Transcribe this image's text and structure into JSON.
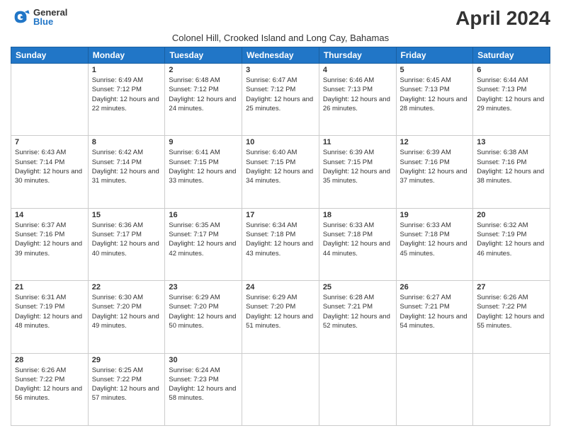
{
  "logo": {
    "general": "General",
    "blue": "Blue"
  },
  "title": "April 2024",
  "subtitle": "Colonel Hill, Crooked Island and Long Cay, Bahamas",
  "days_of_week": [
    "Sunday",
    "Monday",
    "Tuesday",
    "Wednesday",
    "Thursday",
    "Friday",
    "Saturday"
  ],
  "weeks": [
    [
      {
        "day": "",
        "info": ""
      },
      {
        "day": "1",
        "sunrise": "6:49 AM",
        "sunset": "7:12 PM",
        "daylight": "12 hours and 22 minutes."
      },
      {
        "day": "2",
        "sunrise": "6:48 AM",
        "sunset": "7:12 PM",
        "daylight": "12 hours and 24 minutes."
      },
      {
        "day": "3",
        "sunrise": "6:47 AM",
        "sunset": "7:12 PM",
        "daylight": "12 hours and 25 minutes."
      },
      {
        "day": "4",
        "sunrise": "6:46 AM",
        "sunset": "7:13 PM",
        "daylight": "12 hours and 26 minutes."
      },
      {
        "day": "5",
        "sunrise": "6:45 AM",
        "sunset": "7:13 PM",
        "daylight": "12 hours and 28 minutes."
      },
      {
        "day": "6",
        "sunrise": "6:44 AM",
        "sunset": "7:13 PM",
        "daylight": "12 hours and 29 minutes."
      }
    ],
    [
      {
        "day": "7",
        "sunrise": "6:43 AM",
        "sunset": "7:14 PM",
        "daylight": "12 hours and 30 minutes."
      },
      {
        "day": "8",
        "sunrise": "6:42 AM",
        "sunset": "7:14 PM",
        "daylight": "12 hours and 31 minutes."
      },
      {
        "day": "9",
        "sunrise": "6:41 AM",
        "sunset": "7:15 PM",
        "daylight": "12 hours and 33 minutes."
      },
      {
        "day": "10",
        "sunrise": "6:40 AM",
        "sunset": "7:15 PM",
        "daylight": "12 hours and 34 minutes."
      },
      {
        "day": "11",
        "sunrise": "6:39 AM",
        "sunset": "7:15 PM",
        "daylight": "12 hours and 35 minutes."
      },
      {
        "day": "12",
        "sunrise": "6:39 AM",
        "sunset": "7:16 PM",
        "daylight": "12 hours and 37 minutes."
      },
      {
        "day": "13",
        "sunrise": "6:38 AM",
        "sunset": "7:16 PM",
        "daylight": "12 hours and 38 minutes."
      }
    ],
    [
      {
        "day": "14",
        "sunrise": "6:37 AM",
        "sunset": "7:16 PM",
        "daylight": "12 hours and 39 minutes."
      },
      {
        "day": "15",
        "sunrise": "6:36 AM",
        "sunset": "7:17 PM",
        "daylight": "12 hours and 40 minutes."
      },
      {
        "day": "16",
        "sunrise": "6:35 AM",
        "sunset": "7:17 PM",
        "daylight": "12 hours and 42 minutes."
      },
      {
        "day": "17",
        "sunrise": "6:34 AM",
        "sunset": "7:18 PM",
        "daylight": "12 hours and 43 minutes."
      },
      {
        "day": "18",
        "sunrise": "6:33 AM",
        "sunset": "7:18 PM",
        "daylight": "12 hours and 44 minutes."
      },
      {
        "day": "19",
        "sunrise": "6:33 AM",
        "sunset": "7:18 PM",
        "daylight": "12 hours and 45 minutes."
      },
      {
        "day": "20",
        "sunrise": "6:32 AM",
        "sunset": "7:19 PM",
        "daylight": "12 hours and 46 minutes."
      }
    ],
    [
      {
        "day": "21",
        "sunrise": "6:31 AM",
        "sunset": "7:19 PM",
        "daylight": "12 hours and 48 minutes."
      },
      {
        "day": "22",
        "sunrise": "6:30 AM",
        "sunset": "7:20 PM",
        "daylight": "12 hours and 49 minutes."
      },
      {
        "day": "23",
        "sunrise": "6:29 AM",
        "sunset": "7:20 PM",
        "daylight": "12 hours and 50 minutes."
      },
      {
        "day": "24",
        "sunrise": "6:29 AM",
        "sunset": "7:20 PM",
        "daylight": "12 hours and 51 minutes."
      },
      {
        "day": "25",
        "sunrise": "6:28 AM",
        "sunset": "7:21 PM",
        "daylight": "12 hours and 52 minutes."
      },
      {
        "day": "26",
        "sunrise": "6:27 AM",
        "sunset": "7:21 PM",
        "daylight": "12 hours and 54 minutes."
      },
      {
        "day": "27",
        "sunrise": "6:26 AM",
        "sunset": "7:22 PM",
        "daylight": "12 hours and 55 minutes."
      }
    ],
    [
      {
        "day": "28",
        "sunrise": "6:26 AM",
        "sunset": "7:22 PM",
        "daylight": "12 hours and 56 minutes."
      },
      {
        "day": "29",
        "sunrise": "6:25 AM",
        "sunset": "7:22 PM",
        "daylight": "12 hours and 57 minutes."
      },
      {
        "day": "30",
        "sunrise": "6:24 AM",
        "sunset": "7:23 PM",
        "daylight": "12 hours and 58 minutes."
      },
      {
        "day": "",
        "info": ""
      },
      {
        "day": "",
        "info": ""
      },
      {
        "day": "",
        "info": ""
      },
      {
        "day": "",
        "info": ""
      }
    ]
  ]
}
